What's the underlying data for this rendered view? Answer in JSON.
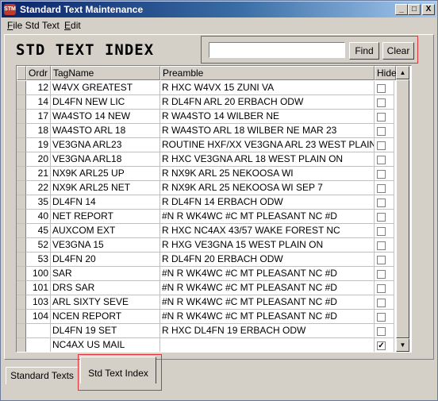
{
  "window": {
    "title": "Standard Text Maintenance",
    "icon_label": "STM",
    "minimize": "_",
    "maximize": "□",
    "close": "X"
  },
  "menu": {
    "file_prefix": "F",
    "file_rest": "ile Std Text",
    "edit_prefix": "E",
    "edit_rest": "dit"
  },
  "heading": "STD TEXT INDEX",
  "search": {
    "value": "",
    "placeholder": ""
  },
  "buttons": {
    "find": "Find",
    "clear": "Clear"
  },
  "columns": {
    "ordr": "Ordr",
    "tagname": "TagName",
    "preamble": "Preamble",
    "hide": "Hide"
  },
  "rows": [
    {
      "ordr": "12",
      "tag": "W4VX GREATEST",
      "preamble": "R HXC W4VX 15 ZUNI VA",
      "hide": false
    },
    {
      "ordr": "14",
      "tag": "DL4FN NEW LIC",
      "preamble": "R DL4FN ARL 20 ERBACH ODW",
      "hide": false
    },
    {
      "ordr": "17",
      "tag": "WA4STO 14 NEW",
      "preamble": "R WA4STO 14 WILBER NE",
      "hide": false
    },
    {
      "ordr": "18",
      "tag": "WA4STO ARL 18",
      "preamble": "R WA4STO ARL 18 WILBER NE MAR 23",
      "hide": false
    },
    {
      "ordr": "19",
      "tag": "VE3GNA ARL23",
      "preamble": "ROUTINE HXF/XX  VE3GNA ARL 23 WEST PLAIN",
      "hide": false
    },
    {
      "ordr": "20",
      "tag": "VE3GNA ARL18",
      "preamble": "R HXC VE3GNA ARL 18 WEST PLAIN ON",
      "hide": false
    },
    {
      "ordr": "21",
      "tag": "NX9K ARL25 UP",
      "preamble": "R NX9K ARL 25 NEKOOSA WI",
      "hide": false
    },
    {
      "ordr": "22",
      "tag": "NX9K ARL25 NET",
      "preamble": "R NX9K ARL 25 NEKOOSA WI SEP 7",
      "hide": false
    },
    {
      "ordr": "35",
      "tag": "DL4FN 14",
      "preamble": "R DL4FN 14 ERBACH ODW",
      "hide": false
    },
    {
      "ordr": "40",
      "tag": "NET REPORT",
      "preamble": "#N R WK4WC #C MT PLEASANT NC #D",
      "hide": false
    },
    {
      "ordr": "45",
      "tag": "AUXCOM EXT",
      "preamble": "R HXC NC4AX 43/57 WAKE FOREST NC",
      "hide": false
    },
    {
      "ordr": "52",
      "tag": "VE3GNA 15",
      "preamble": "R HXG  VE3GNA 15 WEST PLAIN ON",
      "hide": false
    },
    {
      "ordr": "53",
      "tag": "DL4FN 20",
      "preamble": "R DL4FN 20 ERBACH ODW",
      "hide": false
    },
    {
      "ordr": "100",
      "tag": "SAR",
      "preamble": "#N R WK4WC #C MT PLEASANT NC #D",
      "hide": false
    },
    {
      "ordr": "101",
      "tag": "DRS SAR",
      "preamble": "#N R WK4WC #C MT PLEASANT NC #D",
      "hide": false
    },
    {
      "ordr": "103",
      "tag": "ARL SIXTY SEVE",
      "preamble": "#N R WK4WC #C MT PLEASANT NC #D",
      "hide": false
    },
    {
      "ordr": "104",
      "tag": "NCEN REPORT",
      "preamble": "#N R WK4WC #C MT PLEASANT NC #D",
      "hide": false
    },
    {
      "ordr": "",
      "tag": "DL4FN 19 SET",
      "preamble": "R HXC DL4FN 19 ERBACH ODW",
      "hide": false
    },
    {
      "ordr": "",
      "tag": "NC4AX US MAIL",
      "preamble": "",
      "hide": true
    }
  ],
  "scroll": {
    "up": "▲",
    "down": "▼"
  },
  "tabs": [
    {
      "label": "Standard Texts",
      "active": false
    },
    {
      "label": "Std Text Index",
      "active": true
    }
  ],
  "colors": {
    "highlight": "#e0303a",
    "face": "#d4d0c8"
  }
}
